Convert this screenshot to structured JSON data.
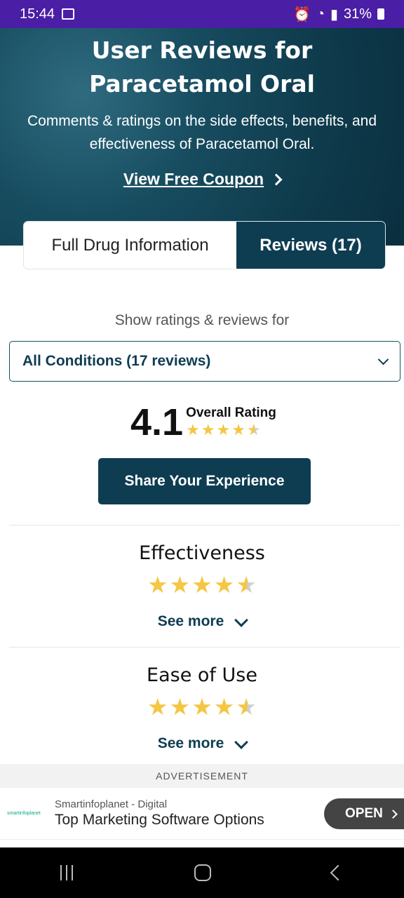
{
  "status": {
    "time": "15:44",
    "battery": "31%"
  },
  "hero": {
    "title": "User Reviews for Paracetamol Oral",
    "subtitle": "Comments & ratings on the side effects, benefits, and effectiveness of Paracetamol Oral.",
    "coupon_link": "View Free Coupon"
  },
  "tabs": [
    {
      "label": "Full Drug Information",
      "active": false
    },
    {
      "label": "Reviews (17)",
      "active": true
    }
  ],
  "filter": {
    "label": "Show ratings & reviews for",
    "selected": "All Conditions (17 reviews)"
  },
  "overall": {
    "score": "4.1",
    "label": "Overall Rating",
    "stars": 4.5
  },
  "share_button": "Share Your Experience",
  "sections": [
    {
      "title": "Effectiveness",
      "stars": 4.5,
      "see_more": "See more"
    },
    {
      "title": "Ease of Use",
      "stars": 4.5,
      "see_more": "See more"
    }
  ],
  "ad": {
    "label": "ADVERTISEMENT",
    "logo_text": "smartinfoplanet",
    "brand": "Smartinfoplanet - Digital",
    "title": "Top Marketing Software Options",
    "button": "OPEN"
  },
  "colors": {
    "primary": "#0e3d52",
    "star": "#f5c643",
    "status_bar": "#4a1ea5"
  }
}
